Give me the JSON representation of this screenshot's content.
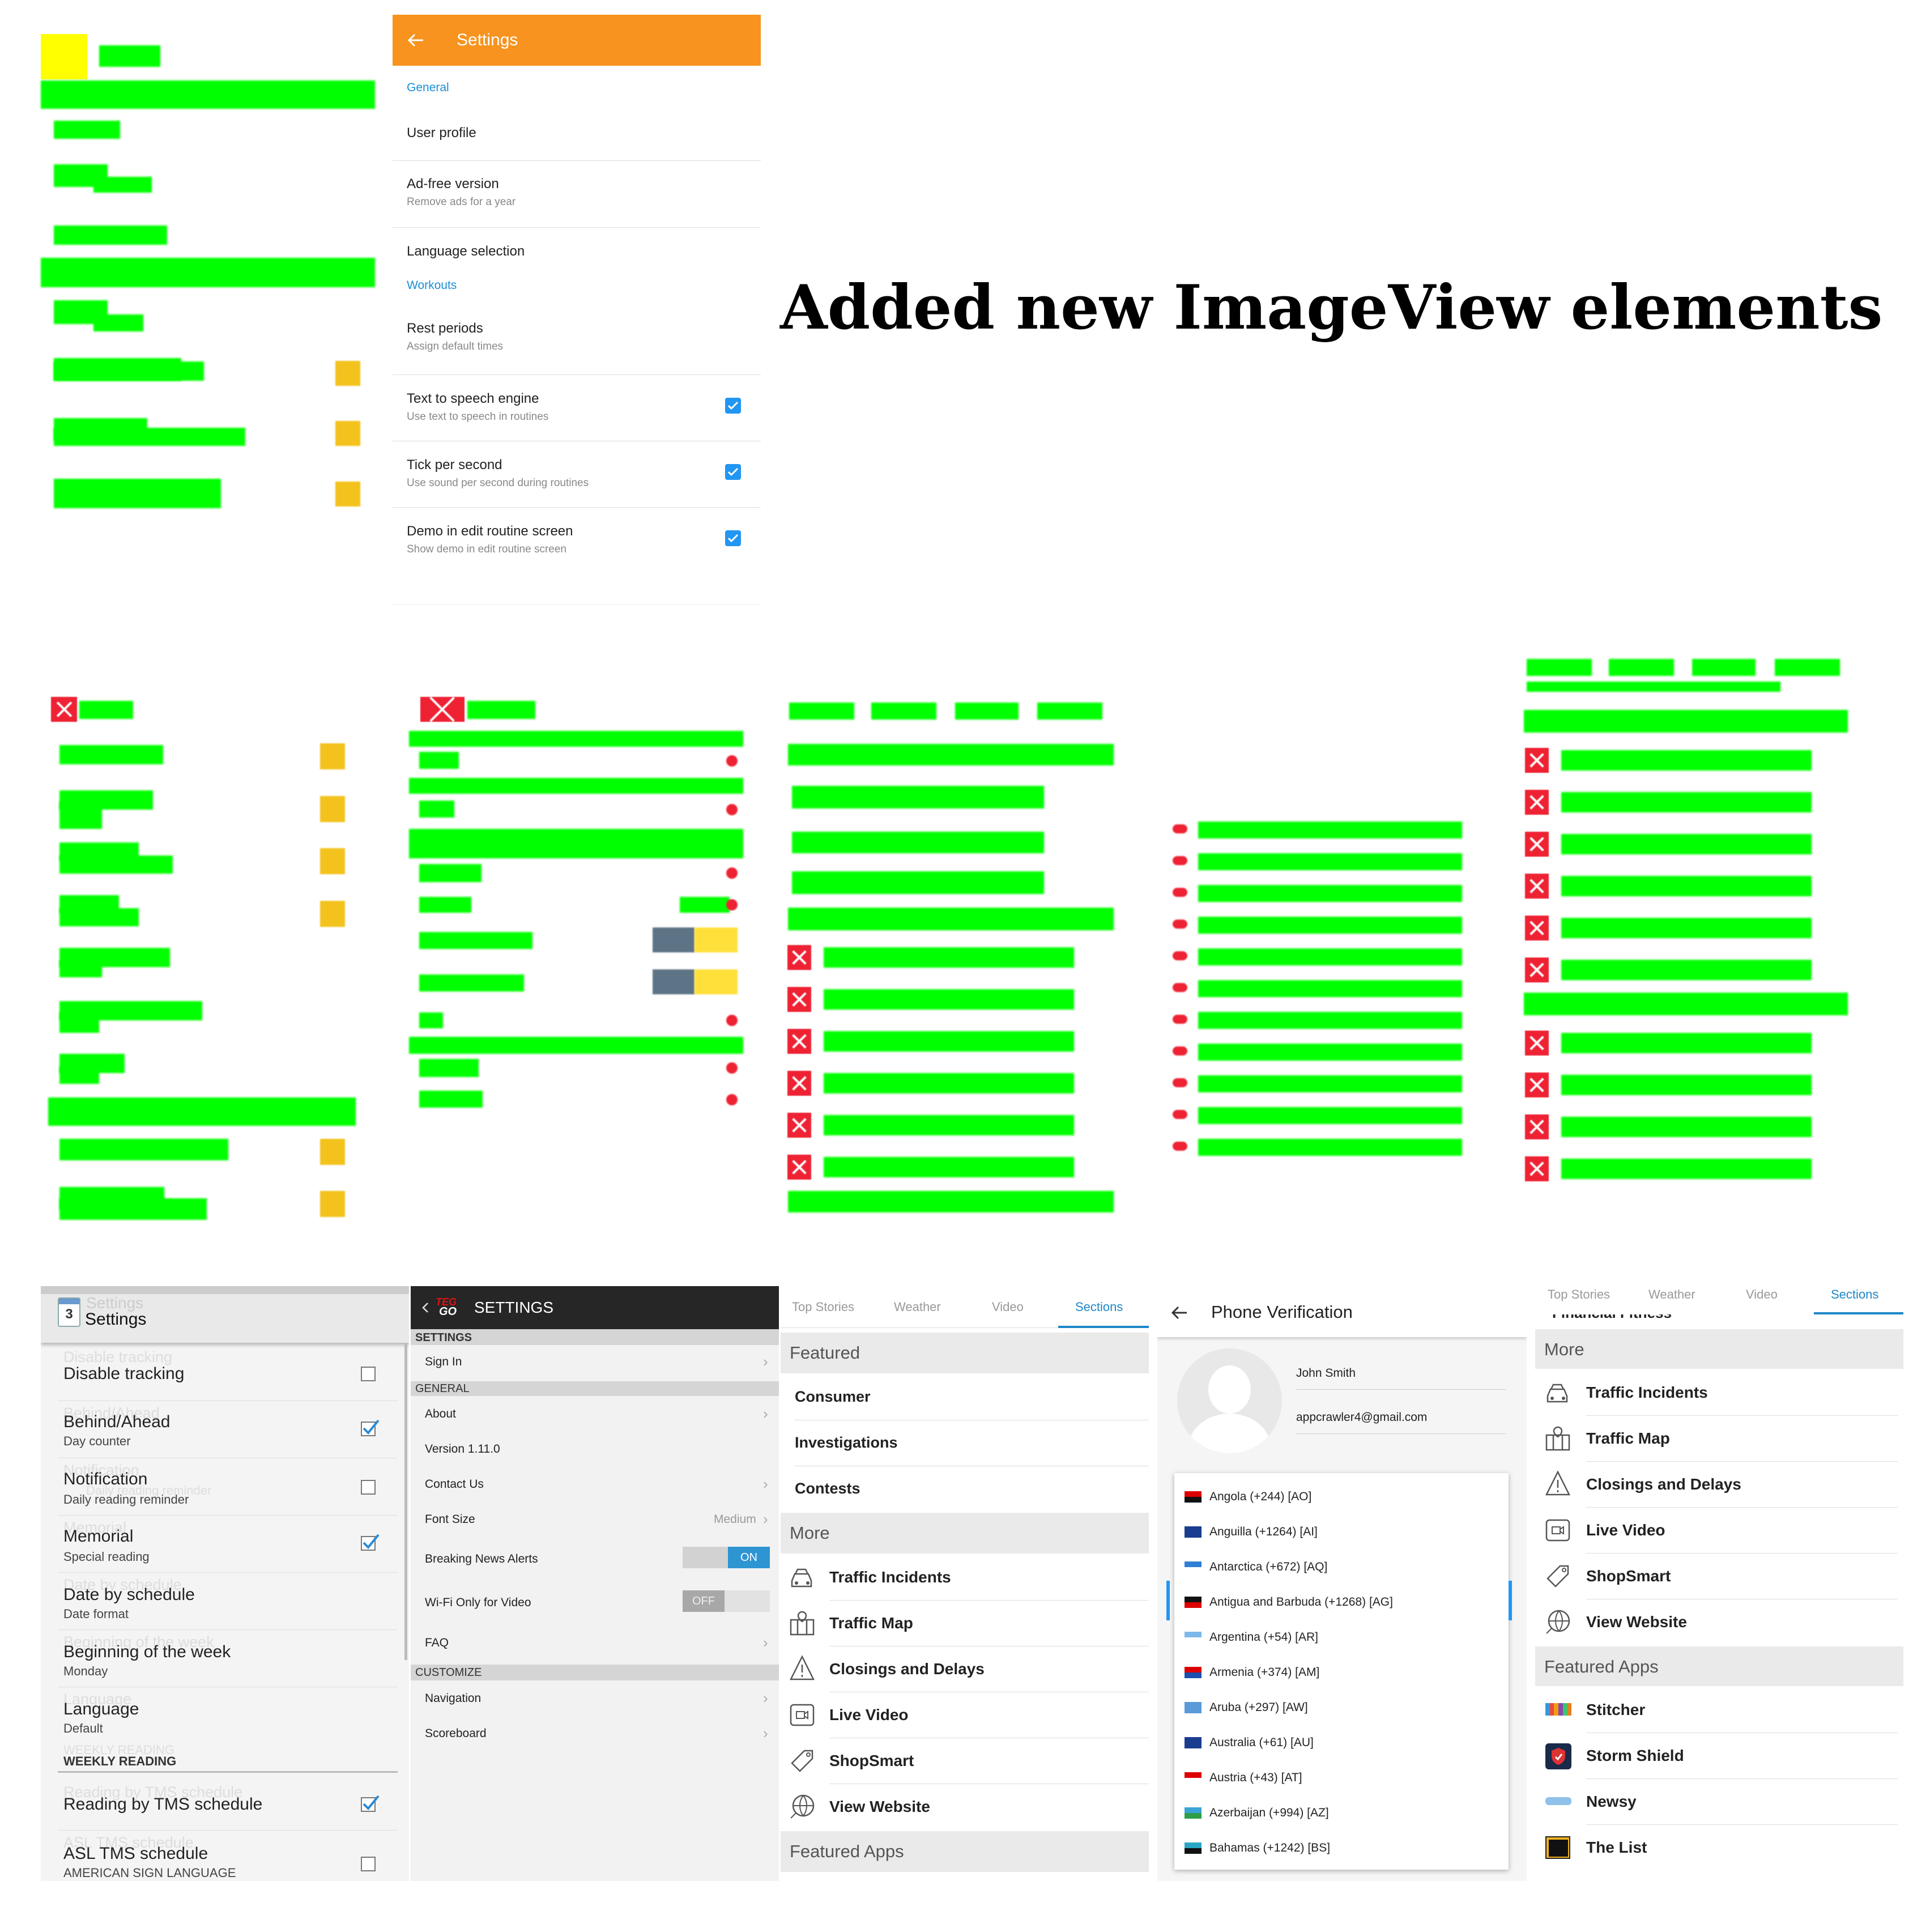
{
  "headline": "Added new ImageView elements",
  "app1": {
    "title": "Settings",
    "sections": [
      {
        "header": "General",
        "items": [
          {
            "label": "User profile",
            "sub": ""
          },
          {
            "label": "Ad-free version",
            "sub": "Remove ads for a year"
          },
          {
            "label": "Language selection",
            "sub": ""
          }
        ]
      },
      {
        "header": "Workouts",
        "items": [
          {
            "label": "Rest periods",
            "sub": "Assign default times"
          },
          {
            "label": "Text to speech engine",
            "sub": "Use text to speech in routines",
            "checked": true
          },
          {
            "label": "Tick per second",
            "sub": "Use sound per second during routines",
            "checked": true
          },
          {
            "label": "Demo in edit routine screen",
            "sub": "Show demo in edit routine screen",
            "checked": true
          }
        ]
      }
    ],
    "accent": "#f7931e"
  },
  "app2": {
    "title": "Settings",
    "icon_text": "3",
    "items": [
      {
        "label": "Disable tracking",
        "sub": "",
        "ghost": "Disable tracking",
        "checked": false
      },
      {
        "label": "Behind/Ahead",
        "sub": "Day counter",
        "ghost": "Behind/Ahead",
        "checked": true
      },
      {
        "label": "Notification",
        "sub": "Daily reading reminder",
        "ghost": "Notification",
        "ghost_sub": "Daily reading reminder",
        "checked": false
      },
      {
        "label": "Memorial",
        "sub": "Special reading",
        "ghost": "Memorial",
        "checked": true
      },
      {
        "label": "Date by schedule",
        "sub": "Date format",
        "ghost": "Date by schedule"
      },
      {
        "label": "Beginning of the week",
        "sub": "Monday",
        "ghost": "Beginning of the week"
      },
      {
        "label": "Language",
        "sub": "Default",
        "ghost": "Language"
      }
    ],
    "section": "WEEKLY READING",
    "section_ghost": "WEEKLY READING",
    "items2": [
      {
        "label": "Reading by TMS schedule",
        "ghost": "Reading by TMS schedule",
        "checked": true
      },
      {
        "label": "ASL TMS schedule",
        "sub": "AMERICAN SIGN LANGUAGE",
        "ghost": "ASL TMS schedule",
        "checked": false
      }
    ]
  },
  "app3": {
    "title": "SETTINGS",
    "logo_top": "TEG",
    "logo_bottom": "GO",
    "sections": [
      {
        "header": "SETTINGS",
        "items": [
          {
            "label": "Sign In",
            "chev": true
          }
        ]
      },
      {
        "header": "GENERAL",
        "items": [
          {
            "label": "About",
            "chev": true
          },
          {
            "label": "Version 1.11.0"
          },
          {
            "label": "Contact Us",
            "chev": true
          },
          {
            "label": "Font Size",
            "value": "Medium",
            "chev": true
          },
          {
            "label": "Breaking News Alerts",
            "toggle": "ON"
          },
          {
            "label": "Wi-Fi Only for Video",
            "toggle": "OFF"
          },
          {
            "label": "FAQ",
            "chev": true
          }
        ]
      },
      {
        "header": "CUSTOMIZE",
        "items": [
          {
            "label": "Navigation",
            "chev": true
          },
          {
            "label": "Scoreboard",
            "chev": true
          }
        ]
      }
    ]
  },
  "app4": {
    "tabs": [
      "Top Stories",
      "Weather",
      "Video",
      "Sections"
    ],
    "active_tab": 3,
    "featured": "Featured",
    "featured_items": [
      "Consumer",
      "Investigations",
      "Contests"
    ],
    "more": "More",
    "more_items": [
      {
        "label": "Traffic Incidents",
        "icon": "car-icon"
      },
      {
        "label": "Traffic Map",
        "icon": "map-icon"
      },
      {
        "label": "Closings and Delays",
        "icon": "warning-icon"
      },
      {
        "label": "Live Video",
        "icon": "video-icon"
      },
      {
        "label": "ShopSmart",
        "icon": "tag-icon"
      },
      {
        "label": "View Website",
        "icon": "globe-icon"
      }
    ],
    "featured_apps": "Featured Apps",
    "accent": "#1e88c8"
  },
  "app5": {
    "title": "Phone Verification",
    "name": "John Smith",
    "email": "appcrawler4@gmail.com",
    "countries": [
      "Angola (+244) [AO]",
      "Anguilla (+1264) [AI]",
      "Antarctica (+672) [AQ]",
      "Antigua and Barbuda (+1268) [AG]",
      "Argentina (+54) [AR]",
      "Armenia (+374) [AM]",
      "Aruba (+297) [AW]",
      "Australia (+61) [AU]",
      "Austria (+43) [AT]",
      "Azerbaijan (+994) [AZ]",
      "Bahamas (+1242) [BS]"
    ]
  },
  "app6": {
    "tabs": [
      "Top Stories",
      "Weather",
      "Video",
      "Sections"
    ],
    "active_tab": 3,
    "cut_item": "Financial Fitness",
    "more": "More",
    "more_items": [
      {
        "label": "Traffic Incidents",
        "icon": "car-icon"
      },
      {
        "label": "Traffic Map",
        "icon": "map-icon"
      },
      {
        "label": "Closings and Delays",
        "icon": "warning-icon"
      },
      {
        "label": "Live Video",
        "icon": "video-icon"
      },
      {
        "label": "ShopSmart",
        "icon": "tag-icon"
      },
      {
        "label": "View Website",
        "icon": "globe-icon"
      }
    ],
    "featured_apps": "Featured Apps",
    "apps": [
      {
        "label": "Stitcher",
        "icon": "stitcher-icon"
      },
      {
        "label": "Storm Shield",
        "icon": "storm-shield-icon"
      },
      {
        "label": "Newsy",
        "icon": "newsy-icon"
      },
      {
        "label": "The List",
        "icon": "the-list-icon"
      }
    ]
  }
}
